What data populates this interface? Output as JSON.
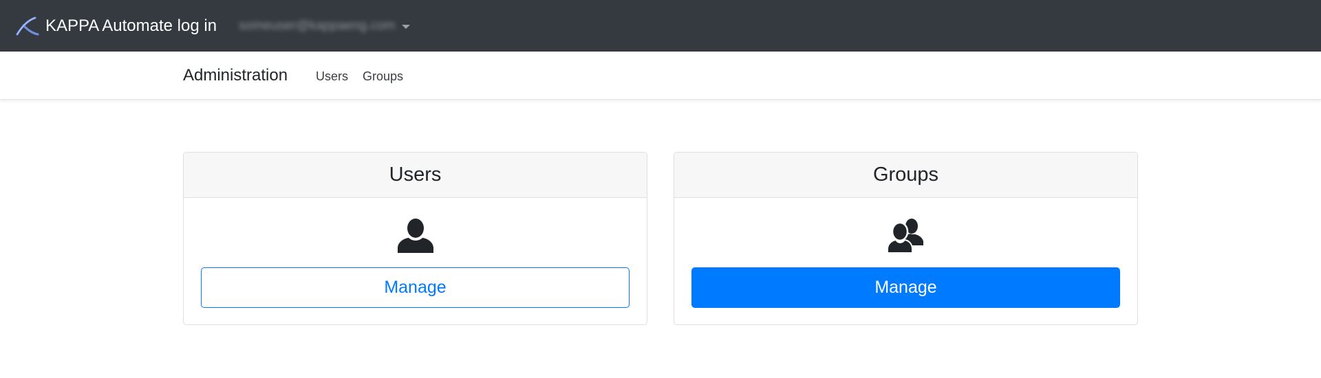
{
  "topbar": {
    "app_title": "KAPPA Automate log in",
    "user_email": "someuser@kappaeng.com",
    "logo_icon": "kappa-logo-icon",
    "menu_icon": "caret-down-icon",
    "background": "#343a40"
  },
  "subnav": {
    "title": "Administration",
    "links": [
      {
        "label": "Users"
      },
      {
        "label": "Groups"
      }
    ]
  },
  "cards": [
    {
      "title": "Users",
      "icon": "user-icon",
      "button_label": "Manage",
      "button_style": "outline"
    },
    {
      "title": "Groups",
      "icon": "users-group-icon",
      "button_label": "Manage",
      "button_style": "solid"
    }
  ],
  "colors": {
    "primary": "#007bff",
    "card_header": "#f7f7f7",
    "text": "#212529"
  }
}
